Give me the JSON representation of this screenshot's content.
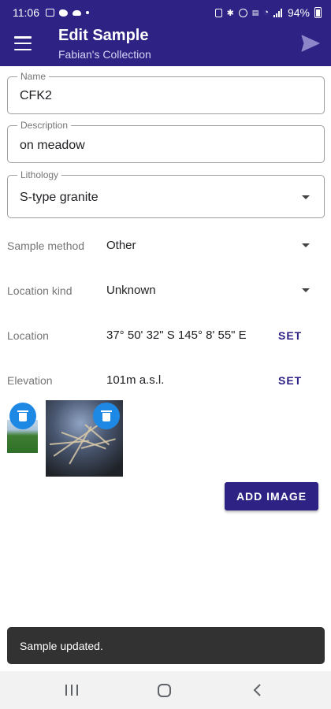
{
  "status_bar": {
    "time": "11:06",
    "battery": "94%",
    "left_icons": [
      "gallery-icon",
      "twitter-icon",
      "cloud-icon",
      "dot-icon"
    ],
    "right_icons": [
      "battery-saver-icon",
      "bluetooth-icon",
      "hotspot-icon",
      "volte-icon",
      "wifi-icon",
      "signal-icon"
    ]
  },
  "app_bar": {
    "title": "Edit Sample",
    "subtitle": "Fabian's Collection",
    "color": "#2e2385"
  },
  "form": {
    "name": {
      "label": "Name",
      "value": "CFK2"
    },
    "description": {
      "label": "Description",
      "value": "on meadow"
    },
    "lithology": {
      "label": "Lithology",
      "value": "S-type granite"
    },
    "sample_method": {
      "label": "Sample method",
      "value": "Other"
    },
    "location_kind": {
      "label": "Location kind",
      "value": "Unknown"
    },
    "location": {
      "label": "Location",
      "value": "37° 50' 32\" S 145° 8' 55\" E",
      "action": "SET"
    },
    "elevation": {
      "label": "Elevation",
      "value": "101m a.s.l.",
      "action": "SET"
    }
  },
  "images": {
    "items": [
      {
        "name": "meadow-photo"
      },
      {
        "name": "tree-night-photo"
      }
    ],
    "add_label": "ADD IMAGE"
  },
  "snackbar": {
    "message": "Sample updated."
  },
  "accent_color": "#1e88e5"
}
